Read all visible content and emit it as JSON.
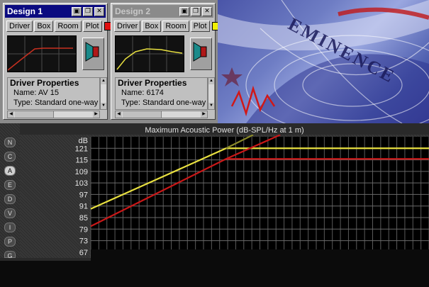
{
  "windows": [
    {
      "title": "Design 1",
      "tabs": [
        "Driver",
        "Box",
        "Room",
        "Plot"
      ],
      "swatch": "#e01010",
      "plot_color": "#c83020",
      "props_heading": "Driver Properties",
      "name_row": "Name: AV 15",
      "type_row": "Type: Standard one-way"
    },
    {
      "title": "Design 2",
      "tabs": [
        "Driver",
        "Box",
        "Room",
        "Plot"
      ],
      "swatch": "#f0f000",
      "plot_color": "#e8e040",
      "props_heading": "Driver Properties",
      "name_row": "Name: 6174",
      "type_row": "Type: Standard one-way"
    }
  ],
  "title_buttons": [
    "save-icon",
    "restore-icon",
    "close-icon"
  ],
  "banner": {
    "text": "EMINENCE"
  },
  "side_buttons": [
    "N",
    "C",
    "A",
    "E",
    "D",
    "V",
    "I",
    "P",
    "G"
  ],
  "active_side_button": "A",
  "graph": {
    "title": "Maximum Acoustic Power (dB-SPL/Hz at 1 m)",
    "unit": "dB"
  },
  "chart_data": {
    "type": "line",
    "title": "Maximum Acoustic Power (dB-SPL/Hz at 1 m)",
    "ylabel": "dB",
    "yticks": [
      121,
      115,
      109,
      103,
      97,
      91,
      85,
      79,
      73,
      67
    ],
    "ylim": [
      64,
      127
    ],
    "xlim": [
      0,
      100
    ],
    "grid": true,
    "series": [
      {
        "color": "#e8e040",
        "x": [
          0,
          40,
          100
        ],
        "y": [
          89.5,
          121,
          121
        ]
      },
      {
        "color": "#c81818",
        "x": [
          0,
          40,
          100
        ],
        "y": [
          80.5,
          115.5,
          115.5
        ]
      },
      {
        "color": "#8a8a2a",
        "x": [
          40,
          48
        ],
        "y": [
          121,
          128
        ]
      },
      {
        "color": "#c81818",
        "x": [
          40,
          56
        ],
        "y": [
          115.5,
          128
        ]
      }
    ]
  }
}
